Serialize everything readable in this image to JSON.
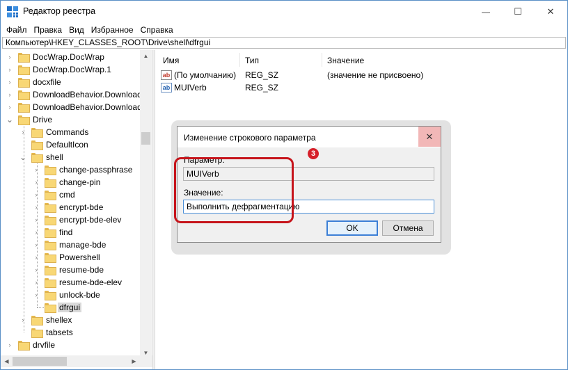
{
  "window": {
    "title": "Редактор реестра",
    "min_glyph": "—",
    "max_glyph": "☐",
    "close_glyph": "✕"
  },
  "menu": [
    "Файл",
    "Правка",
    "Вид",
    "Избранное",
    "Справка"
  ],
  "address": "Компьютер\\HKEY_CLASSES_ROOT\\Drive\\shell\\dfrgui",
  "tree": [
    {
      "label": "DocWrap.DocWrap",
      "indent": 0,
      "expander": "›"
    },
    {
      "label": "DocWrap.DocWrap.1",
      "indent": 0,
      "expander": "›"
    },
    {
      "label": "docxfile",
      "indent": 0,
      "expander": "›"
    },
    {
      "label": "DownloadBehavior.Download",
      "indent": 0,
      "expander": "›"
    },
    {
      "label": "DownloadBehavior.Download",
      "indent": 0,
      "expander": "›"
    },
    {
      "label": "Drive",
      "indent": 0,
      "expander": "⌄"
    },
    {
      "label": "Commands",
      "indent": 1,
      "expander": "›"
    },
    {
      "label": "DefaultIcon",
      "indent": 1,
      "expander": ""
    },
    {
      "label": "shell",
      "indent": 1,
      "expander": "⌄"
    },
    {
      "label": "change-passphrase",
      "indent": 2,
      "expander": "›"
    },
    {
      "label": "change-pin",
      "indent": 2,
      "expander": "›"
    },
    {
      "label": "cmd",
      "indent": 2,
      "expander": "›"
    },
    {
      "label": "encrypt-bde",
      "indent": 2,
      "expander": "›"
    },
    {
      "label": "encrypt-bde-elev",
      "indent": 2,
      "expander": "›"
    },
    {
      "label": "find",
      "indent": 2,
      "expander": "›"
    },
    {
      "label": "manage-bde",
      "indent": 2,
      "expander": "›"
    },
    {
      "label": "Powershell",
      "indent": 2,
      "expander": "›"
    },
    {
      "label": "resume-bde",
      "indent": 2,
      "expander": "›"
    },
    {
      "label": "resume-bde-elev",
      "indent": 2,
      "expander": "›"
    },
    {
      "label": "unlock-bde",
      "indent": 2,
      "expander": "›"
    },
    {
      "label": "dfrgui",
      "indent": 2,
      "expander": "",
      "selected": true
    },
    {
      "label": "shellex",
      "indent": 1,
      "expander": "›"
    },
    {
      "label": "tabsets",
      "indent": 1,
      "expander": ""
    },
    {
      "label": "drvfile",
      "indent": 0,
      "expander": "›"
    }
  ],
  "list": {
    "headers": {
      "name": "Имя",
      "type": "Тип",
      "value": "Значение"
    },
    "rows": [
      {
        "icon": "ab",
        "icon_color": "red",
        "name": "(По умолчанию)",
        "type": "REG_SZ",
        "value": "(значение не присвоено)"
      },
      {
        "icon": "ab",
        "icon_color": "blue",
        "name": "MUIVerb",
        "type": "REG_SZ",
        "value": ""
      }
    ]
  },
  "dialog": {
    "title": "Изменение строкового параметра",
    "param_label": "Параметр:",
    "param_value": "MUIVerb",
    "value_label": "Значение:",
    "value_value": "Выполнить дефрагментацию",
    "ok": "OK",
    "cancel": "Отмена",
    "close_glyph": "✕"
  },
  "annotation": {
    "badge": "3",
    "color": "#c6141b"
  },
  "colors": {
    "folder": "#f8d775",
    "selection": "#d9d9d9",
    "accent": "#3c7fd6",
    "annotation": "#c6141b"
  }
}
